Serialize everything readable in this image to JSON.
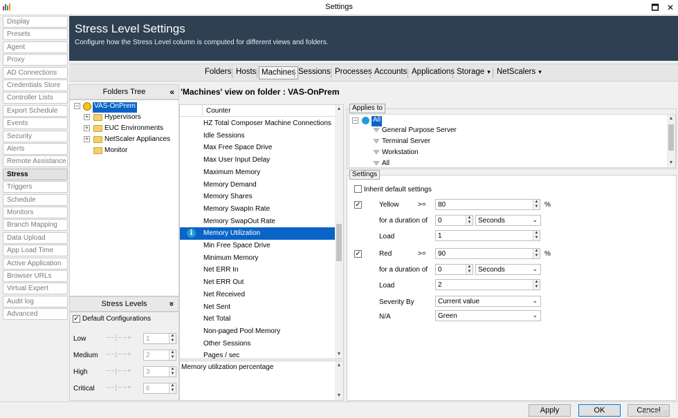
{
  "window": {
    "title": "Settings",
    "minimize_glyph": "🗖",
    "close_glyph": "✕"
  },
  "nav": [
    "Display",
    "Presets",
    "Agent",
    "Proxy",
    "AD Connections",
    "Credentials Store",
    "Controller Lists",
    "Export Schedule",
    "Events",
    "Security",
    "Alerts",
    "Remote Assistance",
    "Stress",
    "Triggers",
    "Schedule",
    "Monitors",
    "Branch Mapping",
    "Data Upload",
    "App Load Time",
    "Active Application",
    "Browser URLs",
    "Virtual Expert",
    "Audit log",
    "Advanced"
  ],
  "nav_active": "Stress",
  "header": {
    "title": "Stress Level Settings",
    "subtitle": "Configure how the Stress Level column is computed for different views and folders."
  },
  "tabs": [
    "Folders",
    "Hosts",
    "Machines",
    "Sessions",
    "Processes",
    "Accounts",
    "Applications",
    "Storage",
    "NetScalers"
  ],
  "tab_active": "Machines",
  "tab_dropdown_glyph": "▾",
  "folders_tree": {
    "title": "Folders Tree",
    "collapse_glyph": "«",
    "root": "VAS-OnPrem",
    "children": [
      "Hypervisors",
      "EUC Environments",
      "NetScaler Appliances",
      "Monitor"
    ]
  },
  "stress_levels": {
    "title": "Stress Levels",
    "collapse_glyph": "»",
    "default_config_label": "Default Configurations",
    "default_config_checked": true,
    "levels": [
      {
        "label": "Low",
        "value": "1"
      },
      {
        "label": "Medium",
        "value": "2"
      },
      {
        "label": "High",
        "value": "3"
      },
      {
        "label": "Critical",
        "value": "6"
      }
    ]
  },
  "view_title": "'Machines' view on folder : VAS-OnPrem",
  "counter_header": "Counter",
  "counters": [
    "HZ Total Composer Machine Connections",
    "Idle Sessions",
    "Max Free Space Drive",
    "Max User Input Delay",
    "Maximum Memory",
    "Memory Demand",
    "Memory Shares",
    "Memory SwapIn Rate",
    "Memory SwapOut Rate",
    "Memory Utilization",
    "Min Free Space Drive",
    "Minimum Memory",
    "Net ERR In",
    "Net ERR Out",
    "Net Received",
    "Net Sent",
    "Net Total",
    "Non-paged Pool Memory",
    "Other Sessions",
    "Pages / sec"
  ],
  "counter_selected": "Memory Utilization",
  "description": "Memory utilization percentage",
  "applies_to": {
    "label": "Applies to",
    "root": "All",
    "items": [
      "General Purpose Server",
      "Terminal Server",
      "Workstation",
      "All"
    ]
  },
  "settings": {
    "label": "Settings",
    "inherit_label": "Inherit default settings",
    "inherit_checked": false,
    "yellow": {
      "label": "Yellow",
      "op": ">=",
      "value": "80",
      "unit": "%",
      "checked": true,
      "duration_label": "for a duration of",
      "duration": "0",
      "duration_unit": "Seconds",
      "load_label": "Load",
      "load": "1"
    },
    "red": {
      "label": "Red",
      "op": ">=",
      "value": "90",
      "unit": "%",
      "checked": true,
      "duration_label": "for a duration of",
      "duration": "0",
      "duration_unit": "Seconds",
      "load_label": "Load",
      "load": "2"
    },
    "severity_label": "Severity By",
    "severity_value": "Current value",
    "na_label": "N/A",
    "na_value": "Green"
  },
  "buttons": {
    "apply": "Apply",
    "ok": "OK",
    "cancel": "Cancel"
  },
  "watermark": "Activat"
}
